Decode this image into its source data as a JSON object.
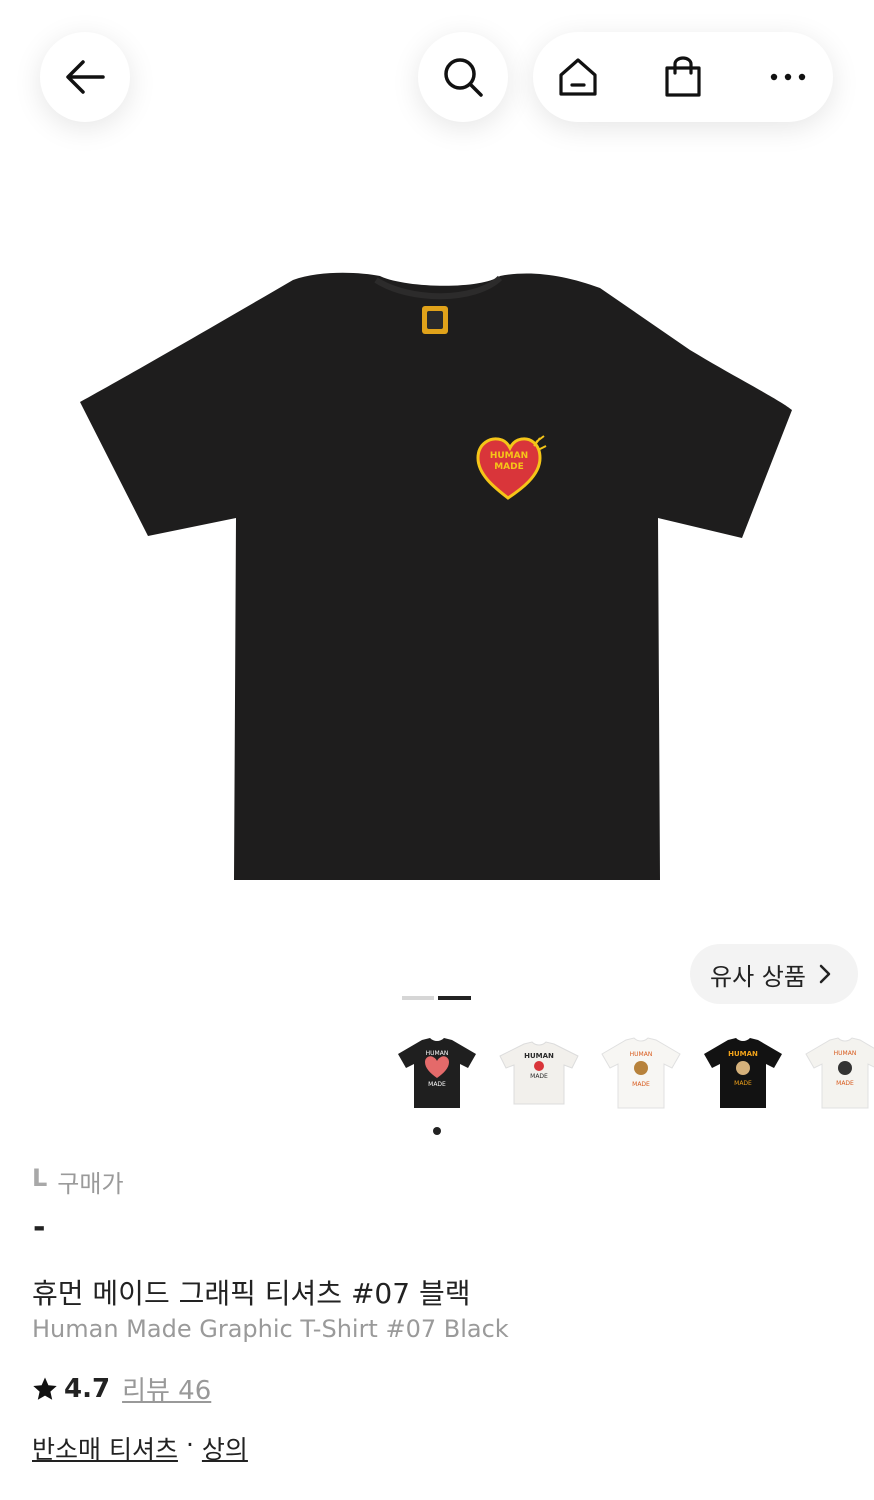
{
  "header": {
    "back_icon": "arrow-left-icon",
    "search_icon": "search-icon",
    "home_icon": "home-icon",
    "cart_icon": "shopping-bag-icon",
    "more_icon": "more-horizontal-icon"
  },
  "product_image": {
    "logo_text_top": "HUMAN",
    "logo_text_bottom": "MADE"
  },
  "similar_button": {
    "label": "유사 상품",
    "icon": "chevron-right-icon"
  },
  "carousel": {
    "total_slides": 2,
    "active_index": 1
  },
  "thumbnails": [
    {
      "color": "black",
      "text": "HUMAN MADE"
    },
    {
      "color": "white",
      "text": "HUMAN MADE"
    },
    {
      "color": "white",
      "text": "HUMAN MADE"
    },
    {
      "color": "black",
      "text": "HUMAN MADE"
    },
    {
      "color": "white",
      "text": "HUMAN MADE"
    }
  ],
  "purchase": {
    "size": "L",
    "price_label": "구매가",
    "price_value": "-"
  },
  "product": {
    "title_ko": "휴먼 메이드 그래픽 티셔츠 #07 블랙",
    "title_en": "Human Made Graphic T-Shirt #07 Black"
  },
  "rating": {
    "icon": "star-icon",
    "score": "4.7",
    "reviews_label": "리뷰 46"
  },
  "categories": {
    "primary": "반소매 티셔츠",
    "separator": "·",
    "secondary": "상의"
  },
  "colors": {
    "shirt_black": "#1e1d1d",
    "heart_red": "#d9353a",
    "heart_yellow": "#f5c518",
    "text_primary": "#222222",
    "text_secondary": "#9a9a9a"
  }
}
